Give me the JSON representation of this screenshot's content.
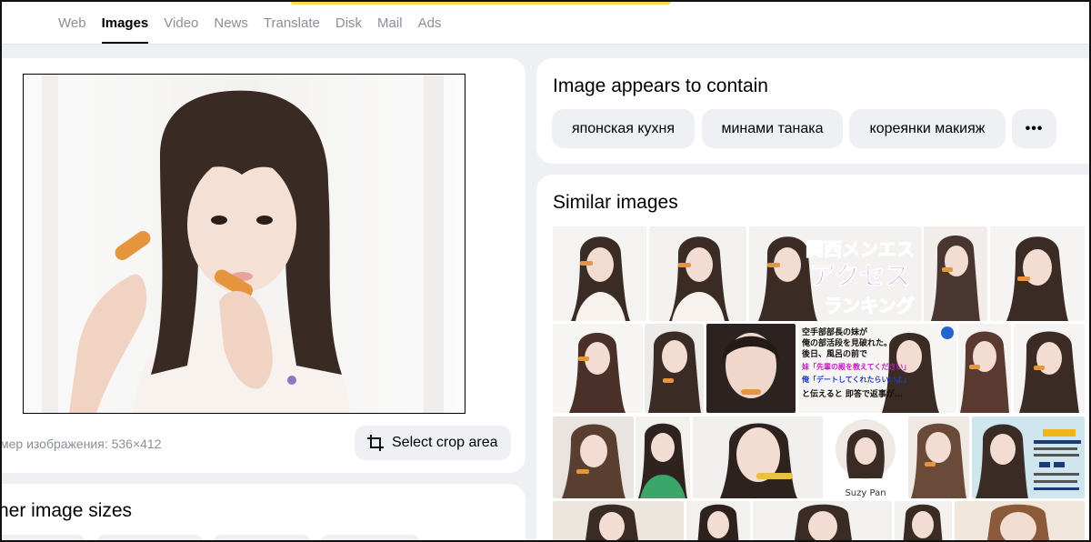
{
  "nav": {
    "tabs": [
      {
        "label": "Web"
      },
      {
        "label": "Images",
        "active": true
      },
      {
        "label": "Video"
      },
      {
        "label": "News"
      },
      {
        "label": "Translate"
      },
      {
        "label": "Disk"
      },
      {
        "label": "Mail"
      },
      {
        "label": "Ads"
      }
    ]
  },
  "preview": {
    "size_label": "мер изображения: 536×412",
    "crop_button": "Select crop area"
  },
  "other_sizes": {
    "title": "her image sizes"
  },
  "contains": {
    "title": "Image appears to contain",
    "tags": [
      "японская кухня",
      "минами танака",
      "кореянки макияж"
    ],
    "more_label": "•••"
  },
  "similar": {
    "title": "Similar images",
    "overlay_banner": {
      "line1": "関西メンエス",
      "line2": "アクセス",
      "line3": "ランキング"
    },
    "overlay_text": {
      "line1": "空手部部長の妹が",
      "line2": "俺の部活段を見破れた。",
      "line3": "後日、風呂の前で",
      "line4": "妹「先輩の殿を教えてください」",
      "line5": "俺「デートしてくれたらいいよ」",
      "line6": "と伝えると 即答で返事が…"
    },
    "thumb_caption": "Suzy Pan"
  },
  "colors": {
    "accent_yellow": "#ffdb4d",
    "background": "#eef0f3",
    "muted_text": "#8a8f97",
    "banner_magenta": "#c51fc5"
  }
}
